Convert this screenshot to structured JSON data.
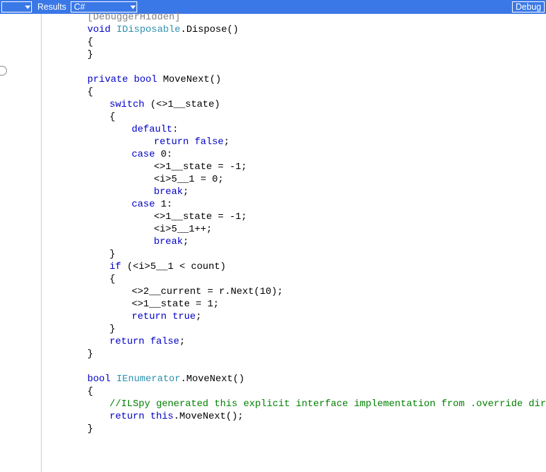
{
  "toolbar": {
    "results_label": "Results",
    "lang_selected": "C#",
    "debug_label": "Debug"
  },
  "code": {
    "lines": [
      {
        "i": 1,
        "tokens": [
          {
            "t": "[DebuggerHidden]",
            "c": "attr"
          }
        ]
      },
      {
        "i": 1,
        "tokens": [
          {
            "t": "void",
            "c": "kw"
          },
          {
            "t": " "
          },
          {
            "t": "IDisposable",
            "c": "tp"
          },
          {
            "t": ".Dispose()"
          }
        ]
      },
      {
        "i": 1,
        "tokens": [
          {
            "t": "{"
          }
        ]
      },
      {
        "i": 1,
        "tokens": [
          {
            "t": "}"
          }
        ]
      },
      {
        "i": 1,
        "tokens": [
          {
            "t": ""
          }
        ]
      },
      {
        "i": 1,
        "tokens": [
          {
            "t": "private",
            "c": "kw"
          },
          {
            "t": " "
          },
          {
            "t": "bool",
            "c": "kw"
          },
          {
            "t": " MoveNext()"
          }
        ]
      },
      {
        "i": 1,
        "tokens": [
          {
            "t": "{"
          }
        ]
      },
      {
        "i": 2,
        "tokens": [
          {
            "t": "switch",
            "c": "kw"
          },
          {
            "t": " (<>1__state)"
          }
        ]
      },
      {
        "i": 2,
        "tokens": [
          {
            "t": "{"
          }
        ]
      },
      {
        "i": 3,
        "tokens": [
          {
            "t": "default",
            "c": "kw"
          },
          {
            "t": ":"
          }
        ]
      },
      {
        "i": 4,
        "tokens": [
          {
            "t": "return",
            "c": "kw"
          },
          {
            "t": " "
          },
          {
            "t": "false",
            "c": "kw"
          },
          {
            "t": ";"
          }
        ]
      },
      {
        "i": 3,
        "tokens": [
          {
            "t": "case",
            "c": "kw"
          },
          {
            "t": " 0:"
          }
        ]
      },
      {
        "i": 4,
        "tokens": [
          {
            "t": "<>1__state = -1;"
          }
        ]
      },
      {
        "i": 4,
        "tokens": [
          {
            "t": "<i>5__1 = 0;"
          }
        ]
      },
      {
        "i": 4,
        "tokens": [
          {
            "t": "break",
            "c": "kw"
          },
          {
            "t": ";"
          }
        ]
      },
      {
        "i": 3,
        "tokens": [
          {
            "t": "case",
            "c": "kw"
          },
          {
            "t": " 1:"
          }
        ]
      },
      {
        "i": 4,
        "tokens": [
          {
            "t": "<>1__state = -1;"
          }
        ]
      },
      {
        "i": 4,
        "tokens": [
          {
            "t": "<i>5__1++;"
          }
        ]
      },
      {
        "i": 4,
        "tokens": [
          {
            "t": "break",
            "c": "kw"
          },
          {
            "t": ";"
          }
        ]
      },
      {
        "i": 2,
        "tokens": [
          {
            "t": "}"
          }
        ]
      },
      {
        "i": 2,
        "tokens": [
          {
            "t": "if",
            "c": "kw"
          },
          {
            "t": " (<i>5__1 < count)"
          }
        ]
      },
      {
        "i": 2,
        "tokens": [
          {
            "t": "{"
          }
        ]
      },
      {
        "i": 3,
        "tokens": [
          {
            "t": "<>2__current = r.Next(10);"
          }
        ]
      },
      {
        "i": 3,
        "tokens": [
          {
            "t": "<>1__state = 1;"
          }
        ]
      },
      {
        "i": 3,
        "tokens": [
          {
            "t": "return",
            "c": "kw"
          },
          {
            "t": " "
          },
          {
            "t": "true",
            "c": "kw"
          },
          {
            "t": ";"
          }
        ]
      },
      {
        "i": 2,
        "tokens": [
          {
            "t": "}"
          }
        ]
      },
      {
        "i": 2,
        "tokens": [
          {
            "t": "return",
            "c": "kw"
          },
          {
            "t": " "
          },
          {
            "t": "false",
            "c": "kw"
          },
          {
            "t": ";"
          }
        ]
      },
      {
        "i": 1,
        "tokens": [
          {
            "t": "}"
          }
        ]
      },
      {
        "i": 1,
        "tokens": [
          {
            "t": ""
          }
        ]
      },
      {
        "i": 1,
        "tokens": [
          {
            "t": "bool",
            "c": "kw"
          },
          {
            "t": " "
          },
          {
            "t": "IEnumerator",
            "c": "tp"
          },
          {
            "t": ".MoveNext()"
          }
        ]
      },
      {
        "i": 1,
        "tokens": [
          {
            "t": "{"
          }
        ]
      },
      {
        "i": 2,
        "tokens": [
          {
            "t": "//ILSpy generated this explicit interface implementation from .override directive",
            "c": "cm"
          }
        ]
      },
      {
        "i": 2,
        "tokens": [
          {
            "t": "return",
            "c": "kw"
          },
          {
            "t": " "
          },
          {
            "t": "this",
            "c": "kw"
          },
          {
            "t": ".MoveNext();"
          }
        ]
      },
      {
        "i": 1,
        "tokens": [
          {
            "t": "}"
          }
        ]
      }
    ]
  }
}
